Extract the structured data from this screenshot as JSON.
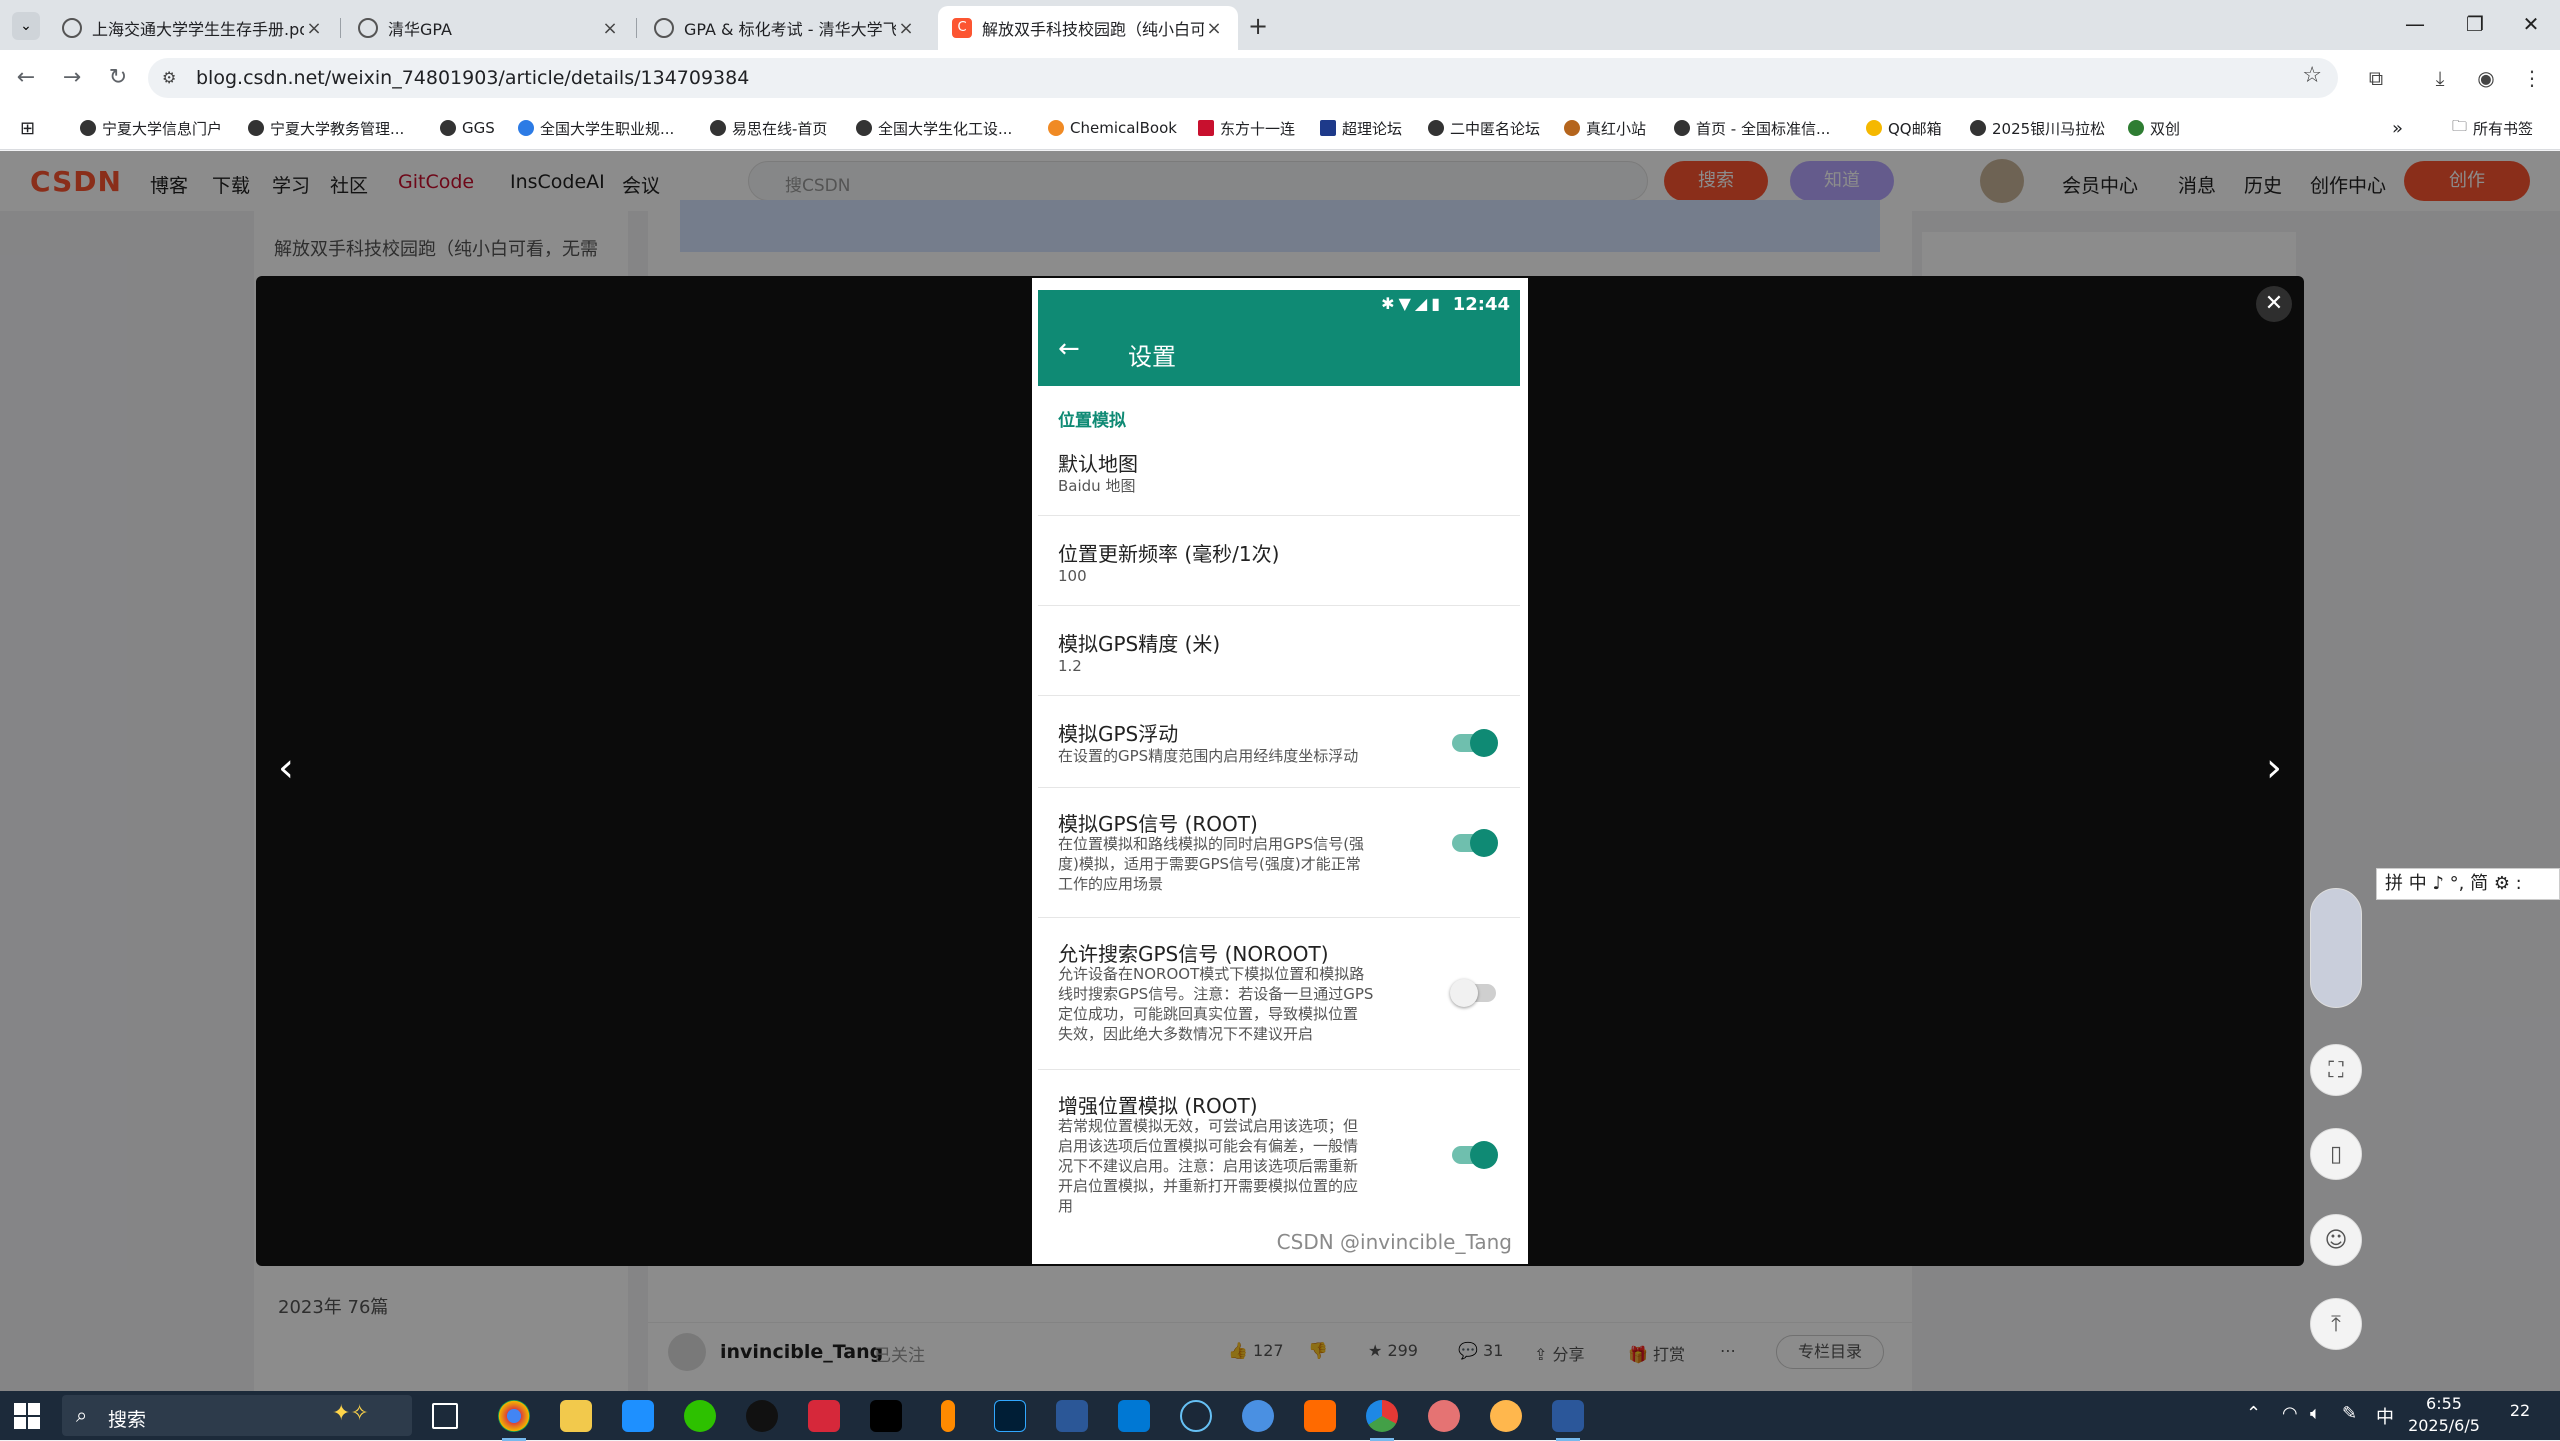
{
  "browser": {
    "tabs": [
      {
        "title": "上海交通大学学生生存手册.pdf",
        "active": false
      },
      {
        "title": "清华GPA",
        "active": false
      },
      {
        "title": "GPA & 标化考试 - 清华大学飞",
        "active": false
      },
      {
        "title": "解放双手科技校园跑（纯小白可",
        "active": true
      }
    ],
    "new_tab": "+",
    "url": "blog.csdn.net/weixin_74801903/article/details/134709384",
    "bookmarks": [
      "宁夏大学信息门户",
      "宁夏大学教务管理...",
      "GGS",
      "全国大学生职业规...",
      "易思在线-首页",
      "全国大学生化工设...",
      "ChemicalBook",
      "东方十一连",
      "超理论坛",
      "二中匿名论坛",
      "真红小站",
      "首页 - 全国标准信...",
      "QQ邮箱",
      "2025银川马拉松",
      "双创"
    ],
    "all_bookmarks": "所有书签"
  },
  "csdn": {
    "logo": "CSDN",
    "nav": [
      "博客",
      "下载",
      "学习",
      "社区",
      "GitCode",
      "InsCodeAI",
      "会议"
    ],
    "search_placeholder": "搜CSDN",
    "search_button": "搜索",
    "zhidao_button": "知道",
    "links": [
      "会员中心",
      "消息",
      "历史",
      "创作中心"
    ],
    "create_button": "创作",
    "left_panel": {
      "item1": "解放双手科技校园跑（纯小白可看，无需",
      "archive1": "2023年 76篇"
    },
    "article_footer": {
      "author": "invincible_Tang",
      "follow": "已关注",
      "likes": "127",
      "favorites": "299",
      "comments": "31",
      "share": "分享",
      "print": "打赏",
      "column_dir": "专栏目录"
    }
  },
  "viewer": {
    "close": "✕",
    "prev": "‹",
    "next": "›",
    "phone": {
      "time": "12:44",
      "title": "设置",
      "section": "位置模拟",
      "settings": [
        {
          "title": "默认地图",
          "subtitle": "Baidu 地图"
        },
        {
          "title": "位置更新频率 (毫秒/1次)",
          "subtitle": "100"
        },
        {
          "title": "模拟GPS精度 (米)",
          "subtitle": "1.2"
        },
        {
          "title": "模拟GPS浮动",
          "subtitle": "在设置的GPS精度范围内启用经纬度坐标浮动",
          "toggle": true
        },
        {
          "title": "模拟GPS信号 (ROOT)",
          "subtitle": "在位置模拟和路线模拟的同时启用GPS信号(强\n度)模拟，适用于需要GPS信号(强度)才能正常\n工作的应用场景",
          "toggle": true
        },
        {
          "title": "允许搜索GPS信号 (NOROOT)",
          "subtitle": "允许设备在NOROOT模式下模拟位置和模拟路\n线时搜索GPS信号。注意：若设备一旦通过GPS\n定位成功，可能跳回真实位置，导致模拟位置\n失效，因此绝大多数情况下不建议开启",
          "toggle": false
        },
        {
          "title": "增强位置模拟 (ROOT)",
          "subtitle": "若常规位置模拟无效，可尝试启用该选项；但\n启用该选项后位置模拟可能会有偏差，一般情\n况下不建议启用。注意：启用该选项后需重新\n开启位置模拟，并重新打开需要模拟位置的应\n用",
          "toggle": true
        }
      ],
      "watermark": "CSDN @invincible_Tang"
    }
  },
  "ime": "拼 中 ♪ °, 简 ⚙ :",
  "taskbar": {
    "search_placeholder": "搜索",
    "time": "6:55",
    "date": "2025/6/5",
    "lang": "中",
    "notifications": "22"
  },
  "colors": {
    "accent": "#fc5531",
    "teal": "#0f8a74",
    "taskbar": "#1c2a3a"
  }
}
